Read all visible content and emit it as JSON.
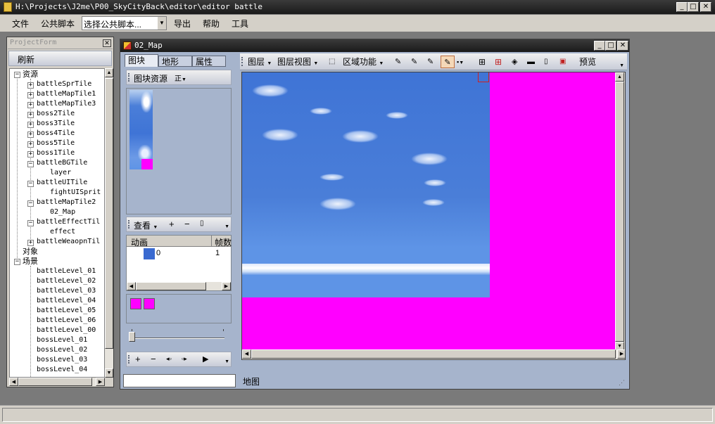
{
  "window": {
    "title": "H:\\Projects\\J2me\\P00_SkyCityBack\\editor\\editor battle"
  },
  "menu": {
    "file": "文件",
    "public_script": "公共脚本",
    "script_select": "选择公共脚本...",
    "export": "导出",
    "help": "帮助",
    "tools": "工具"
  },
  "project_form": {
    "title": "ProjectForm",
    "refresh": "刷新",
    "tree": {
      "resources": "资源",
      "items": [
        "battleSprTile",
        "battleMapTile1",
        "battleMapTile3",
        "boss2Tile",
        "boss3Tile",
        "boss4Tile",
        "boss5Tile",
        "boss1Tile",
        "battleBGTile",
        "layer",
        "battleUITile",
        "fightUISprit",
        "battleMapTile2",
        "02_Map",
        "battleEffectTil",
        "effect",
        "battleWeaopnTil"
      ],
      "objects": "对象",
      "scenes": "场景",
      "scene_items": [
        "battleLevel_01",
        "battleLevel_02",
        "battleLevel_03",
        "battleLevel_04",
        "battleLevel_05",
        "battleLevel_06",
        "battleLevel_00",
        "bossLevel_01",
        "bossLevel_02",
        "bossLevel_03",
        "bossLevel_04"
      ]
    }
  },
  "map_window": {
    "title": "02_Map",
    "tabs": [
      "图块",
      "地形",
      "属性"
    ],
    "tile_source_label": "图块资源",
    "tile_source_value": "正",
    "view_label": "查看",
    "anim_table": {
      "headers": [
        "动画",
        "帧数"
      ],
      "row_index": "0",
      "row_frames": "1"
    },
    "toolbar": {
      "layer": "图层",
      "layer_view": "图层视图",
      "region": "区域功能",
      "preview": "预览"
    },
    "status": "地图"
  },
  "colors": {
    "magenta": "#ff00ff",
    "sky_top": "#3f74d6",
    "sky_bottom": "#5e94e6"
  }
}
